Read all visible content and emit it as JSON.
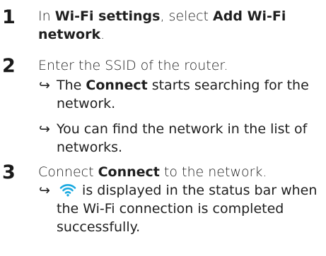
{
  "steps": [
    {
      "number": "1",
      "text_pre": "In ",
      "bold1": "Wi-Fi settings",
      "text_mid": ", select ",
      "bold2": "Add Wi-Fi network",
      "text_post": "."
    },
    {
      "number": "2",
      "text": "Enter the SSID of the router.",
      "results": [
        {
          "text_pre": "The ",
          "bold": "Connect",
          "text_post": " starts searching for the network."
        },
        {
          "text": "You can find the network in the list of networks."
        }
      ]
    },
    {
      "number": "3",
      "text_pre": "Connect ",
      "bold": "Connect",
      "text_post": " to the network.",
      "result": {
        "icon": "wifi-icon",
        "text_post": "is displayed in the status bar when the Wi-Fi connection is completed successfully."
      }
    }
  ],
  "symbols": {
    "arrow": "↪"
  },
  "colors": {
    "wifi": "#1aa9e0",
    "text": "#1f1f1f"
  }
}
